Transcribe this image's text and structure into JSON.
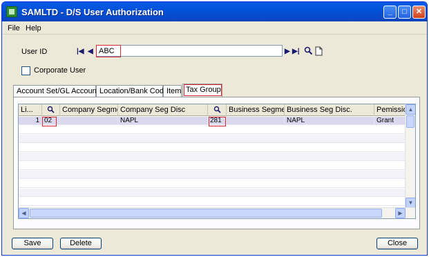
{
  "window": {
    "title": "SAMLTD - D/S User Authorization",
    "minimize": "_",
    "maximize": "□",
    "close": "✕"
  },
  "menu": [
    "File",
    "Help"
  ],
  "user": {
    "label": "User ID",
    "value": "ABC"
  },
  "corporate_user": {
    "label": "Corporate User",
    "checked": false
  },
  "tabs": [
    {
      "label": "Account Set/GL Account",
      "active": false
    },
    {
      "label": "Location/Bank Code",
      "active": false
    },
    {
      "label": "Item",
      "active": false
    },
    {
      "label": "Tax Group",
      "active": true
    }
  ],
  "grid": {
    "columns": [
      "Li...",
      "Company Segment",
      "Company Seg Disc",
      "Business Segment",
      "Business Seg Disc.",
      "Pemission"
    ],
    "rows": [
      {
        "line": "1",
        "company_code": "02",
        "company_segment": "",
        "company_seg_disc": "NAPL",
        "business_code": "281",
        "business_segment": "",
        "business_seg_disc": "NAPL",
        "permission": "Grant"
      }
    ]
  },
  "buttons": {
    "save": "Save",
    "delete": "Delete",
    "close": "Close"
  },
  "icons": {
    "first": "first-record-icon",
    "prev": "previous-record-icon",
    "next": "next-record-icon",
    "last": "last-record-icon",
    "finder": "search-icon",
    "new": "new-document-icon"
  }
}
